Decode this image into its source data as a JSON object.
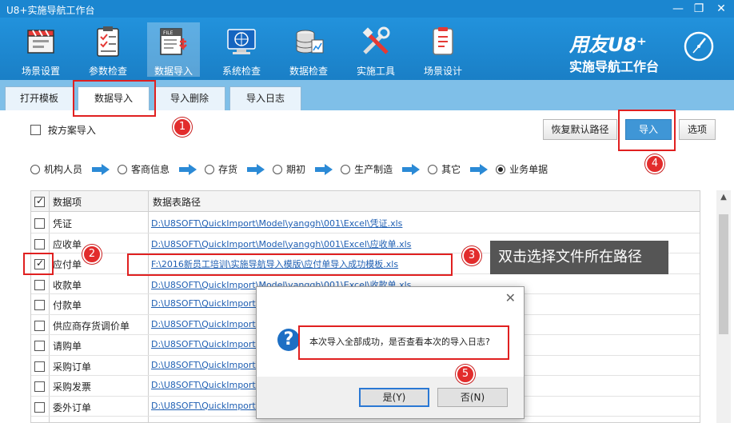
{
  "window": {
    "title": "U8+实施导航工作台",
    "controls": {
      "minimize": "—",
      "restore": "❐",
      "close": "✕"
    }
  },
  "ribbon": {
    "items": [
      {
        "label": "场景设置",
        "icon": "clapperboard-icon"
      },
      {
        "label": "参数检查",
        "icon": "clipboard-check-icon"
      },
      {
        "label": "数据导入",
        "icon": "file-import-icon",
        "active": true
      },
      {
        "label": "系统检查",
        "icon": "monitor-check-icon"
      },
      {
        "label": "数据检查",
        "icon": "database-chart-icon"
      },
      {
        "label": "实施工具",
        "icon": "tools-icon"
      },
      {
        "label": "场景设计",
        "icon": "design-icon"
      }
    ],
    "brand": {
      "line1": "用友U8⁺",
      "line2": "实施导航工作台",
      "icon": "compass-icon"
    }
  },
  "tabs": [
    {
      "label": "打开模板"
    },
    {
      "label": "数据导入",
      "active": true
    },
    {
      "label": "导入删除"
    },
    {
      "label": "导入日志"
    }
  ],
  "toolbar": {
    "plan_import_label": "按方案导入",
    "plan_import_checked": false,
    "restore_path_label": "恢复默认路径",
    "import_label": "导入",
    "options_label": "选项"
  },
  "steps": [
    {
      "label": "机构人员",
      "selected": false
    },
    {
      "label": "客商信息",
      "selected": false
    },
    {
      "label": "存货",
      "selected": false
    },
    {
      "label": "期初",
      "selected": false
    },
    {
      "label": "生产制造",
      "selected": false
    },
    {
      "label": "其它",
      "selected": false
    },
    {
      "label": "业务单据",
      "selected": true
    }
  ],
  "table": {
    "headers": {
      "item": "数据项",
      "path": "数据表路径"
    },
    "header_checked": true,
    "rows": [
      {
        "name": "凭证",
        "checked": false,
        "path": "D:\\U8SOFT\\QuickImport\\Model\\yanggh\\001\\Excel\\凭证.xls"
      },
      {
        "name": "应收单",
        "checked": false,
        "path": "D:\\U8SOFT\\QuickImport\\Model\\yanggh\\001\\Excel\\应收单.xls"
      },
      {
        "name": "应付单",
        "checked": true,
        "path": "F:\\2016新员工培训\\实施导航导入模版\\应付单导入成功模板.xls"
      },
      {
        "name": "收款单",
        "checked": false,
        "path": "D:\\U8SOFT\\QuickImport\\Model\\yanggh\\001\\Excel\\收款单.xls"
      },
      {
        "name": "付款单",
        "checked": false,
        "path": "D:\\U8SOFT\\QuickImport\\M"
      },
      {
        "name": "供应商存货调价单",
        "checked": false,
        "path": "D:\\U8SOFT\\QuickImport\\M"
      },
      {
        "name": "请购单",
        "checked": false,
        "path": "D:\\U8SOFT\\QuickImport\\M"
      },
      {
        "name": "采购订单",
        "checked": false,
        "path": "D:\\U8SOFT\\QuickImport\\M"
      },
      {
        "name": "采购发票",
        "checked": false,
        "path": "D:\\U8SOFT\\QuickImport\\M"
      },
      {
        "name": "委外订单",
        "checked": false,
        "path": "D:\\U8SOFT\\QuickImport\\M"
      }
    ]
  },
  "dialog": {
    "message": "本次导入全部成功，是否查看本次的导入日志?",
    "yes_label": "是(Y)",
    "no_label": "否(N)",
    "icon": "question-icon"
  },
  "annotations": {
    "badges": [
      "1",
      "2",
      "3",
      "4",
      "5"
    ],
    "tooltip": "双击选择文件所在路径",
    "color": "#e02020"
  }
}
